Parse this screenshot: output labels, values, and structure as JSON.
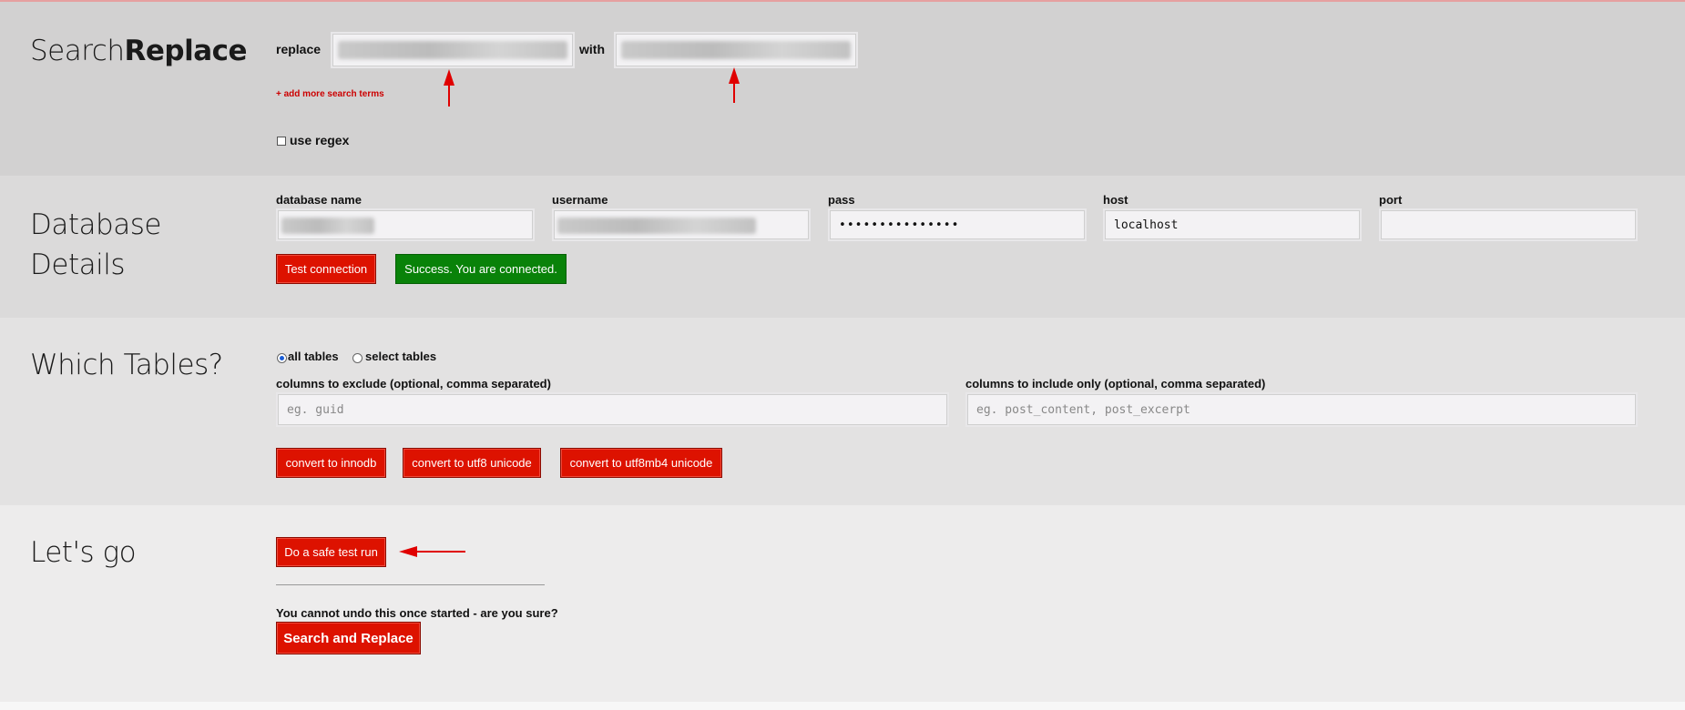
{
  "search_replace": {
    "title_light": "Search",
    "title_bold": "Replace",
    "replace_label": "replace",
    "with_label": "with",
    "add_more_link": "+ add more search terms",
    "regex_label": "use regex"
  },
  "database": {
    "title_line1": "Database",
    "title_line2": "Details",
    "fields": {
      "db_name_label": "database name",
      "username_label": "username",
      "pass_label": "pass",
      "pass_value": "•••••••••••••••",
      "host_label": "host",
      "host_value": "localhost",
      "port_label": "port",
      "port_value": ""
    },
    "test_button": "Test connection",
    "success_message": "Success. You are connected."
  },
  "tables": {
    "title": "Which Tables?",
    "radio_all": "all tables",
    "radio_select": "select tables",
    "exclude_label": "columns to exclude (optional, comma separated)",
    "exclude_placeholder": "eg. guid",
    "include_label": "columns to include only (optional, comma separated)",
    "include_placeholder": "eg. post_content, post_excerpt",
    "btn_innodb": "convert to innodb",
    "btn_utf8": "convert to utf8 unicode",
    "btn_utf8mb4": "convert to utf8mb4 unicode"
  },
  "go": {
    "title": "Let's go",
    "dry_run_button": "Do a safe test run",
    "warning": "You cannot undo this once started - are you sure?",
    "run_button": "Search and Replace"
  },
  "colors": {
    "button_red": "#dd1200",
    "success_green": "#098209",
    "arrow_red": "#e00000"
  }
}
